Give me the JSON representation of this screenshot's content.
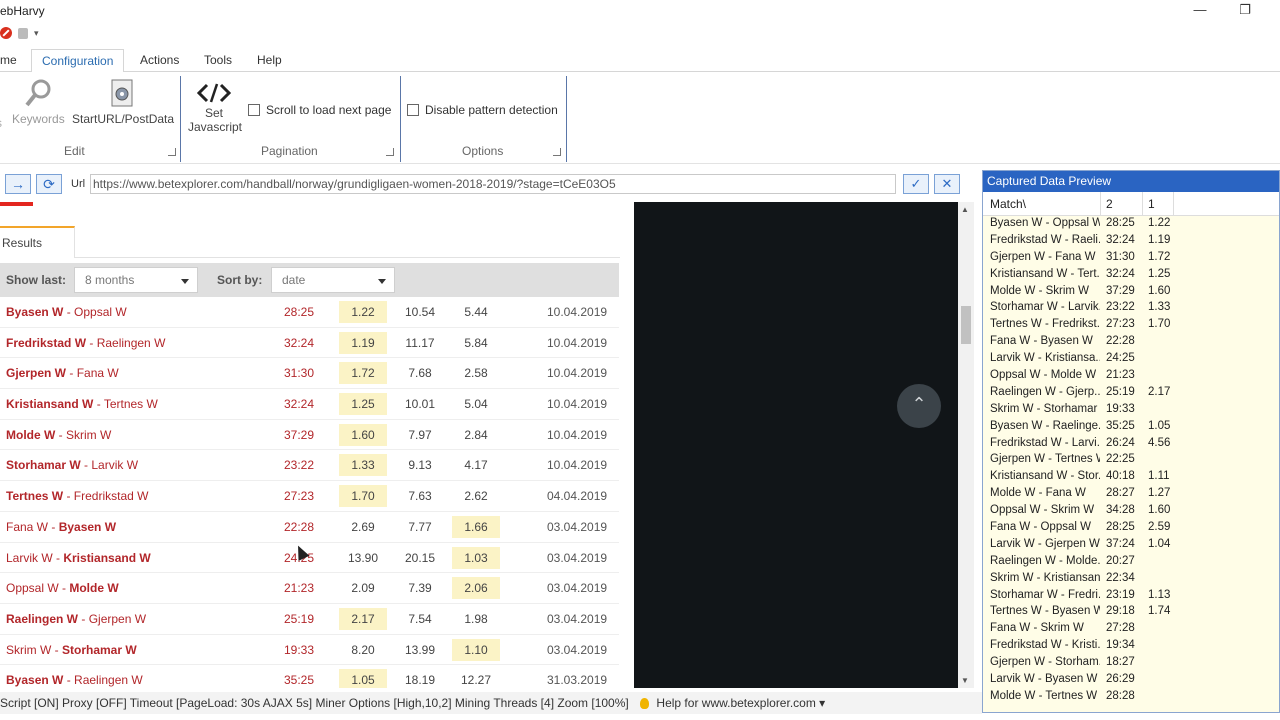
{
  "window": {
    "title": "ebHarvy"
  },
  "ribbon": {
    "tabs": [
      "me",
      "Configuration",
      "Actions",
      "Tools",
      "Help"
    ],
    "buttons": {
      "keywords": "Keywords",
      "start_url": "StartURL/PostData",
      "set_js_1": "Set",
      "set_js_2": "Javascript"
    },
    "checkboxes": {
      "scroll": "Scroll to load next page",
      "disable": "Disable pattern detection"
    },
    "groups": {
      "edit": "Edit",
      "pagination": "Pagination",
      "options": "Options"
    }
  },
  "address": {
    "label": "Url",
    "url": "https://www.betexplorer.com/handball/norway/grundigligaen-women-2018-2019/?stage=tCeE03O5"
  },
  "page": {
    "results_tab": "Results",
    "filters": {
      "show_last_label": "Show last:",
      "show_last_value": "8 months",
      "sort_label": "Sort by:",
      "sort_value": "date"
    },
    "matches": [
      {
        "home": "Byasen W",
        "away": "Oppsal W",
        "winner": "home",
        "score": "28:25",
        "o1": "1.22",
        "o2": "10.54",
        "o3": "5.44",
        "hl": 1,
        "date": "10.04.2019"
      },
      {
        "home": "Fredrikstad W",
        "away": "Raelingen W",
        "winner": "home",
        "score": "32:24",
        "o1": "1.19",
        "o2": "11.17",
        "o3": "5.84",
        "hl": 1,
        "date": "10.04.2019"
      },
      {
        "home": "Gjerpen W",
        "away": "Fana W",
        "winner": "home",
        "score": "31:30",
        "o1": "1.72",
        "o2": "7.68",
        "o3": "2.58",
        "hl": 1,
        "date": "10.04.2019"
      },
      {
        "home": "Kristiansand W",
        "away": "Tertnes W",
        "winner": "home",
        "score": "32:24",
        "o1": "1.25",
        "o2": "10.01",
        "o3": "5.04",
        "hl": 1,
        "date": "10.04.2019"
      },
      {
        "home": "Molde W",
        "away": "Skrim W",
        "winner": "home",
        "score": "37:29",
        "o1": "1.60",
        "o2": "7.97",
        "o3": "2.84",
        "hl": 1,
        "date": "10.04.2019"
      },
      {
        "home": "Storhamar W",
        "away": "Larvik W",
        "winner": "home",
        "score": "23:22",
        "o1": "1.33",
        "o2": "9.13",
        "o3": "4.17",
        "hl": 1,
        "date": "10.04.2019"
      },
      {
        "home": "Tertnes W",
        "away": "Fredrikstad W",
        "winner": "home",
        "score": "27:23",
        "o1": "1.70",
        "o2": "7.63",
        "o3": "2.62",
        "hl": 1,
        "date": "04.04.2019"
      },
      {
        "home": "Fana W",
        "away": "Byasen W",
        "winner": "away",
        "score": "22:28",
        "o1": "2.69",
        "o2": "7.77",
        "o3": "1.66",
        "hl": 3,
        "date": "03.04.2019"
      },
      {
        "home": "Larvik W",
        "away": "Kristiansand W",
        "winner": "away",
        "score": "24:25",
        "o1": "13.90",
        "o2": "20.15",
        "o3": "1.03",
        "hl": 3,
        "date": "03.04.2019"
      },
      {
        "home": "Oppsal W",
        "away": "Molde W",
        "winner": "away",
        "score": "21:23",
        "o1": "2.09",
        "o2": "7.39",
        "o3": "2.06",
        "hl": 3,
        "date": "03.04.2019"
      },
      {
        "home": "Raelingen W",
        "away": "Gjerpen W",
        "winner": "home",
        "score": "25:19",
        "o1": "2.17",
        "o2": "7.54",
        "o3": "1.98",
        "hl": 1,
        "date": "03.04.2019"
      },
      {
        "home": "Skrim W",
        "away": "Storhamar W",
        "winner": "away",
        "score": "19:33",
        "o1": "8.20",
        "o2": "13.99",
        "o3": "1.10",
        "hl": 3,
        "date": "03.04.2019"
      },
      {
        "home": "Byasen W",
        "away": "Raelingen W",
        "winner": "home",
        "score": "35:25",
        "o1": "1.05",
        "o2": "18.19",
        "o3": "12.27",
        "hl": 1,
        "date": "31.03.2019"
      }
    ]
  },
  "preview": {
    "title": "Captured Data Preview",
    "headers": [
      "Match\\",
      "2",
      "1"
    ],
    "rows": [
      [
        "Byasen W - Oppsal W",
        "28:25",
        "1.22"
      ],
      [
        "Fredrikstad W - Raeli...",
        "32:24",
        "1.19"
      ],
      [
        "Gjerpen W - Fana W",
        "31:30",
        "1.72"
      ],
      [
        "Kristiansand W - Tert...",
        "32:24",
        "1.25"
      ],
      [
        "Molde W - Skrim W",
        "37:29",
        "1.60"
      ],
      [
        "Storhamar W - Larvik...",
        "23:22",
        "1.33"
      ],
      [
        "Tertnes W - Fredrikst...",
        "27:23",
        "1.70"
      ],
      [
        "Fana W - Byasen W",
        "22:28",
        ""
      ],
      [
        "Larvik W - Kristiansa...",
        "24:25",
        ""
      ],
      [
        "Oppsal W - Molde W",
        "21:23",
        ""
      ],
      [
        "Raelingen W - Gjerp...",
        "25:19",
        "2.17"
      ],
      [
        "Skrim W - Storhamar ...",
        "19:33",
        ""
      ],
      [
        "Byasen W - Raelinge...",
        "35:25",
        "1.05"
      ],
      [
        "Fredrikstad W - Larvi...",
        "26:24",
        "4.56"
      ],
      [
        "Gjerpen W - Tertnes W",
        "22:25",
        ""
      ],
      [
        "Kristiansand W - Stor...",
        "40:18",
        "1.11"
      ],
      [
        "Molde W - Fana W",
        "28:27",
        "1.27"
      ],
      [
        "Oppsal W - Skrim W",
        "34:28",
        "1.60"
      ],
      [
        "Fana W - Oppsal W",
        "28:25",
        "2.59"
      ],
      [
        "Larvik W - Gjerpen W",
        "37:24",
        "1.04"
      ],
      [
        "Raelingen W - Molde...",
        "20:27",
        ""
      ],
      [
        "Skrim W - Kristiansan...",
        "22:34",
        ""
      ],
      [
        "Storhamar W - Fredri...",
        "23:19",
        "1.13"
      ],
      [
        "Tertnes W - Byasen W",
        "29:18",
        "1.74"
      ],
      [
        "Fana W - Skrim W",
        "27:28",
        ""
      ],
      [
        "Fredrikstad W - Kristi...",
        "19:34",
        ""
      ],
      [
        "Gjerpen W - Storham...",
        "18:27",
        ""
      ],
      [
        "Larvik W - Byasen W",
        "26:29",
        ""
      ],
      [
        "Molde W - Tertnes W",
        "28:28",
        ""
      ]
    ]
  },
  "status": {
    "text": "Script [ON] Proxy [OFF] Timeout [PageLoad: 30s AJAX 5s] Miner Options [High,10,2] Mining Threads [4] Zoom [100%]",
    "help": "Help for www.betexplorer.com ▾"
  }
}
